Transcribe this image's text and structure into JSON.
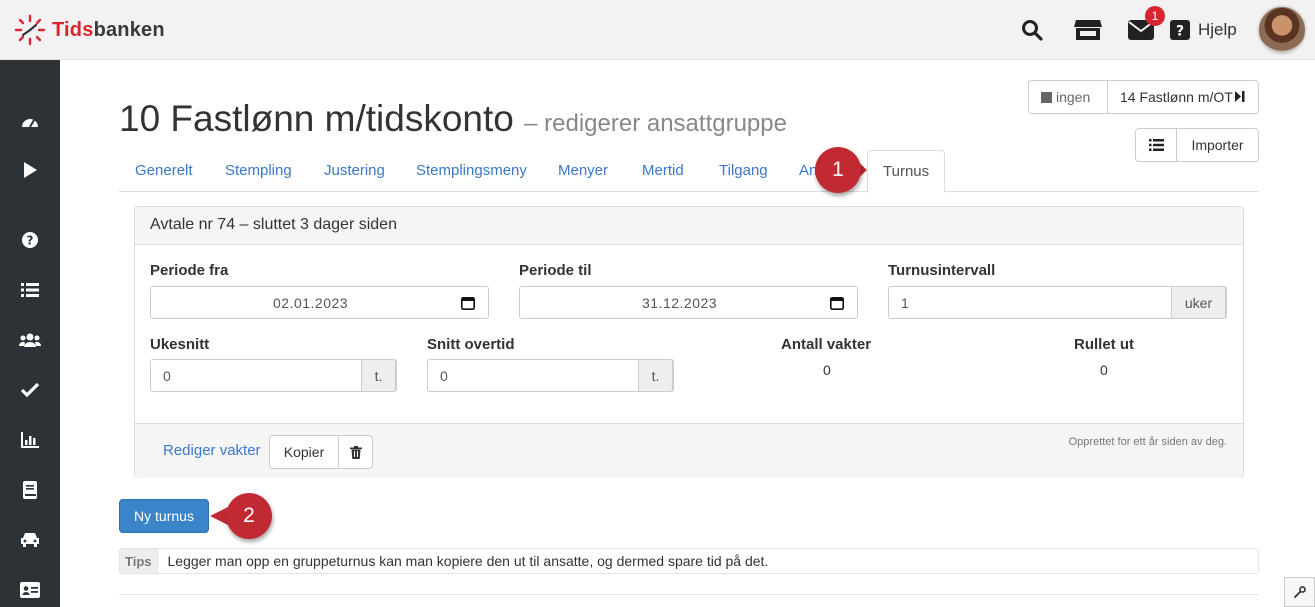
{
  "app": {
    "logo_text_red": "Tids",
    "logo_text_dark": "banken"
  },
  "topbar": {
    "notification_count": "1",
    "help_label": "Hjelp"
  },
  "header": {
    "title": "10 Fastlønn m/tidskonto",
    "subtitle": "– redigerer ansattgruppe",
    "nav_prev_label": "ingen",
    "nav_next_label": "14 Fastlønn m/OT",
    "import_label": "Importer"
  },
  "tabs": [
    {
      "label": "Generelt"
    },
    {
      "label": "Stempling"
    },
    {
      "label": "Justering"
    },
    {
      "label": "Stemplingsmeny"
    },
    {
      "label": "Menyer"
    },
    {
      "label": "Mertid"
    },
    {
      "label": "Tilgang"
    },
    {
      "label": "An"
    },
    {
      "label": "Turnus"
    }
  ],
  "panel": {
    "heading": "Avtale nr 74 – sluttet 3 dager siden",
    "periode_fra": {
      "label": "Periode fra",
      "value": "02.01.2023"
    },
    "periode_til": {
      "label": "Periode til",
      "value": "31.12.2023"
    },
    "turnusintervall": {
      "label": "Turnusintervall",
      "value": "1",
      "unit": "uker"
    },
    "ukesnitt": {
      "label": "Ukesnitt",
      "value": "0",
      "unit": "t."
    },
    "snitt_overtid": {
      "label": "Snitt overtid",
      "value": "0",
      "unit": "t."
    },
    "antall_vakter": {
      "label": "Antall vakter",
      "value": "0"
    },
    "rullet_ut": {
      "label": "Rullet ut",
      "value": "0"
    },
    "footer": {
      "edit_shifts_label": "Rediger vakter",
      "copy_label": "Kopier",
      "created_note": "Opprettet for ett år siden av deg."
    }
  },
  "new_rota_label": "Ny turnus",
  "tips": {
    "label": "Tips",
    "text": "Legger man opp en gruppeturnus kan man kopiere den ut til ansatte, og dermed spare tid på det."
  },
  "callouts": [
    {
      "number": "1"
    },
    {
      "number": "2"
    }
  ],
  "colors": {
    "brand_red": "#d7262f",
    "sidebar_bg": "#2d3237",
    "link_blue": "#3b78c8",
    "primary_button": "#3c84c9",
    "callout_red": "#c12a33"
  }
}
